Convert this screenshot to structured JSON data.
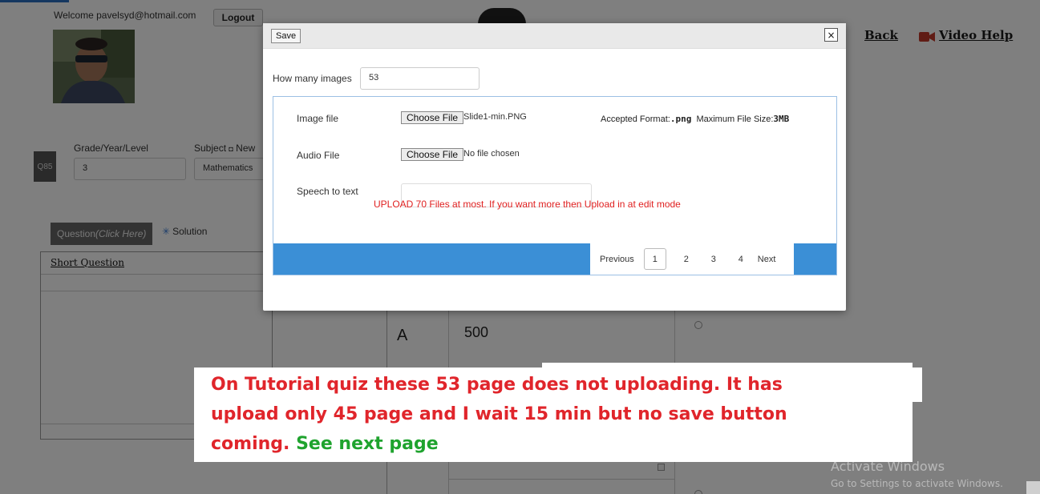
{
  "header": {
    "welcome_text": "Welcome pavelsyd@hotmail.com",
    "logout_label": "Logout",
    "back_label": "Back",
    "video_help_label": "Video Help"
  },
  "question_form": {
    "badge": "Q85",
    "grade_label": "Grade/Year/Level",
    "grade_value": "3",
    "subject_label": "Subject",
    "subject_new": "New",
    "subject_value": "Mathematics",
    "tab_question_label": "Question",
    "tab_question_hint": "(Click Here)",
    "tab_solution_label": "Solution",
    "short_question_label": "Short Question"
  },
  "answers": {
    "option_letter": "A",
    "option_value": "500"
  },
  "modal": {
    "save_label": "Save",
    "close_label": "×",
    "image_count_label": "How many images",
    "image_count_value": "53",
    "image_file_label": "Image file",
    "image_choose_label": "Choose File",
    "image_file_name": "Slide1-min.PNG",
    "format_prefix": "Accepted Format:",
    "format_value": ".png",
    "size_prefix": "Maximum File Size:",
    "size_value": "3MB",
    "audio_file_label": "Audio File",
    "audio_choose_label": "Choose File",
    "audio_file_name": "No file chosen",
    "speech_label": "Speech to text",
    "upload_warning": "UPLOAD 70 Files at most. If you want more then Upload  in at edit mode",
    "pagination": {
      "previous": "Previous",
      "pages": [
        "1",
        "2",
        "3",
        "4"
      ],
      "current": "1",
      "next": "Next"
    }
  },
  "annotation": {
    "line1": "On Tutorial quiz these 53",
    "line1_b": "page",
    "line1_c": "does not uploading. It has",
    "line2": "upload only 45 page and I wait 15 min but no save button",
    "line3": "coming.",
    "line3_green": "See next page"
  },
  "watermark": {
    "title": "Activate Windows",
    "subtitle": "Go to Settings to activate Windows."
  },
  "colors": {
    "pager_bar": "#3b8fd6",
    "annotation_red": "#e0252b",
    "annotation_green": "#1fa32e",
    "warning_red": "#e02020"
  }
}
